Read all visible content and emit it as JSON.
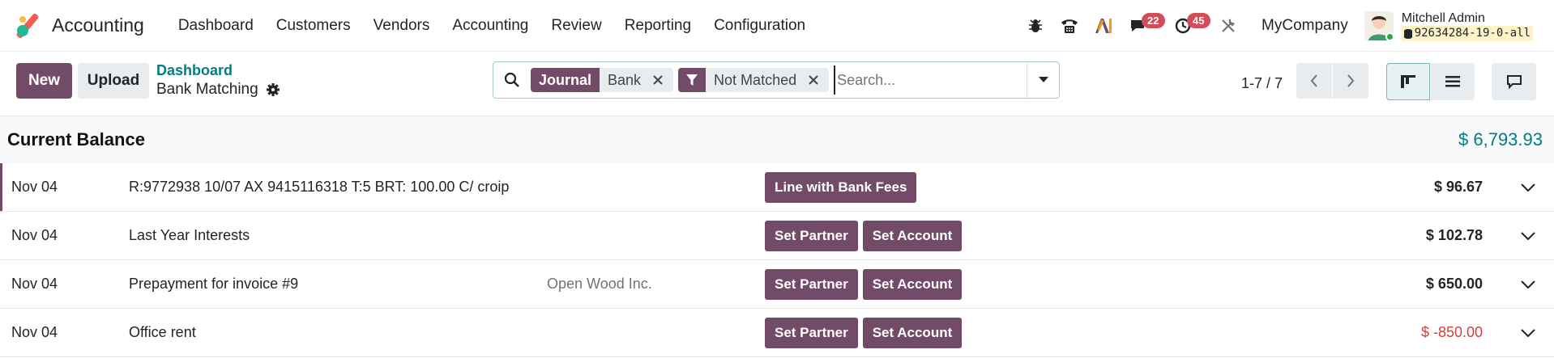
{
  "app": {
    "title": "Accounting"
  },
  "menu": [
    "Dashboard",
    "Customers",
    "Vendors",
    "Accounting",
    "Review",
    "Reporting",
    "Configuration"
  ],
  "systray": {
    "messages_count": "22",
    "activities_count": "45",
    "company": "MyCompany",
    "user_name": "Mitchell Admin",
    "database": "92634284-19-0-all"
  },
  "control": {
    "new_label": "New",
    "upload_label": "Upload",
    "breadcrumb_parent": "Dashboard",
    "breadcrumb_current": "Bank Matching",
    "pager": "1-7 / 7"
  },
  "search": {
    "facets": [
      {
        "label": "Journal",
        "value": "Bank"
      },
      {
        "label": "",
        "value": "Not Matched"
      }
    ],
    "placeholder": "Search..."
  },
  "balance": {
    "label": "Current Balance",
    "value": "$ 6,793.93"
  },
  "rows": [
    {
      "date": "Nov 04",
      "label": "R:9772938 10/07 AX 9415116318 T:5 BRT: 100.00 C/ croip",
      "partner": "",
      "actions": [
        "Line with Bank Fees"
      ],
      "amount": "$ 96.67"
    },
    {
      "date": "Nov 04",
      "label": "Last Year Interests",
      "partner": "",
      "actions": [
        "Set Partner",
        "Set Account"
      ],
      "amount": "$ 102.78"
    },
    {
      "date": "Nov 04",
      "label": "Prepayment for invoice #9",
      "partner": "Open Wood Inc.",
      "actions": [
        "Set Partner",
        "Set Account"
      ],
      "amount": "$ 650.00"
    },
    {
      "date": "Nov 04",
      "label": "Office rent",
      "partner": "",
      "actions": [
        "Set Partner",
        "Set Account"
      ],
      "amount": "$ -850.00"
    }
  ],
  "colors": {
    "brand": "#714b67",
    "teal": "#017e84",
    "negative": "#d23f3a",
    "badge": "#d44c59"
  }
}
